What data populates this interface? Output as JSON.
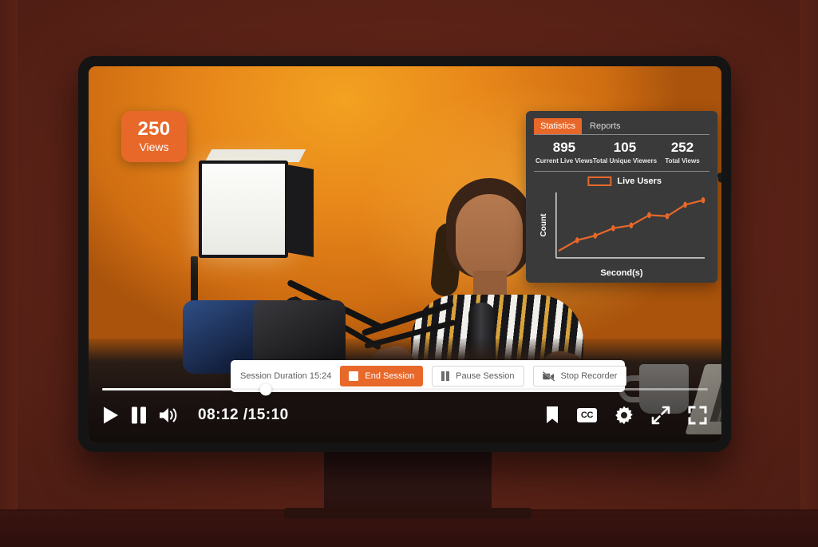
{
  "badge": {
    "count": "250",
    "label": "Views"
  },
  "stats_panel": {
    "tabs": [
      {
        "label": "Statistics",
        "active": true
      },
      {
        "label": "Reports",
        "active": false
      }
    ],
    "kpis": [
      {
        "value": "895",
        "label": "Current Live Views"
      },
      {
        "value": "105",
        "label": "Total Unique Viewers"
      },
      {
        "value": "252",
        "label": "Total Views"
      }
    ],
    "legend_label": "Live Users",
    "accent_color": "#e8682a",
    "panel_color": "#3a3a3a"
  },
  "chart_data": {
    "type": "line",
    "title": "",
    "xlabel": "Second(s)",
    "ylabel": "Count",
    "legend": [
      "Live Users"
    ],
    "legend_position": "top-center",
    "grid": false,
    "series": [
      {
        "name": "Live Users",
        "color": "#e8682a",
        "x": [
          0,
          1,
          2,
          3,
          4,
          5,
          6,
          7,
          8
        ],
        "values": [
          8,
          26,
          34,
          47,
          52,
          70,
          68,
          88,
          96
        ]
      }
    ],
    "xlim": [
      0,
      8
    ],
    "ylim": [
      0,
      100
    ],
    "axis_color": "#cfcfcf"
  },
  "session_bar": {
    "duration_label": "Session Duration 15:24",
    "buttons": [
      {
        "label": "End Session",
        "style": "primary",
        "icon": "stop-square-icon"
      },
      {
        "label": "Pause Session",
        "style": "ghost",
        "icon": "pause-icon"
      },
      {
        "label": "Stop Recorder",
        "style": "ghost",
        "icon": "video-off-icon"
      }
    ]
  },
  "player": {
    "time_display": "08:12 /15:10",
    "current_time": "08:12",
    "total_time": "15:10",
    "progress_percent": 27,
    "left_controls": [
      "play-icon",
      "pause-icon",
      "volume-icon"
    ],
    "right_controls": [
      "bookmark-icon",
      "cc-icon",
      "settings-gear-icon",
      "expand-arrows-icon",
      "fullscreen-icon"
    ],
    "cc_label": "CC"
  }
}
